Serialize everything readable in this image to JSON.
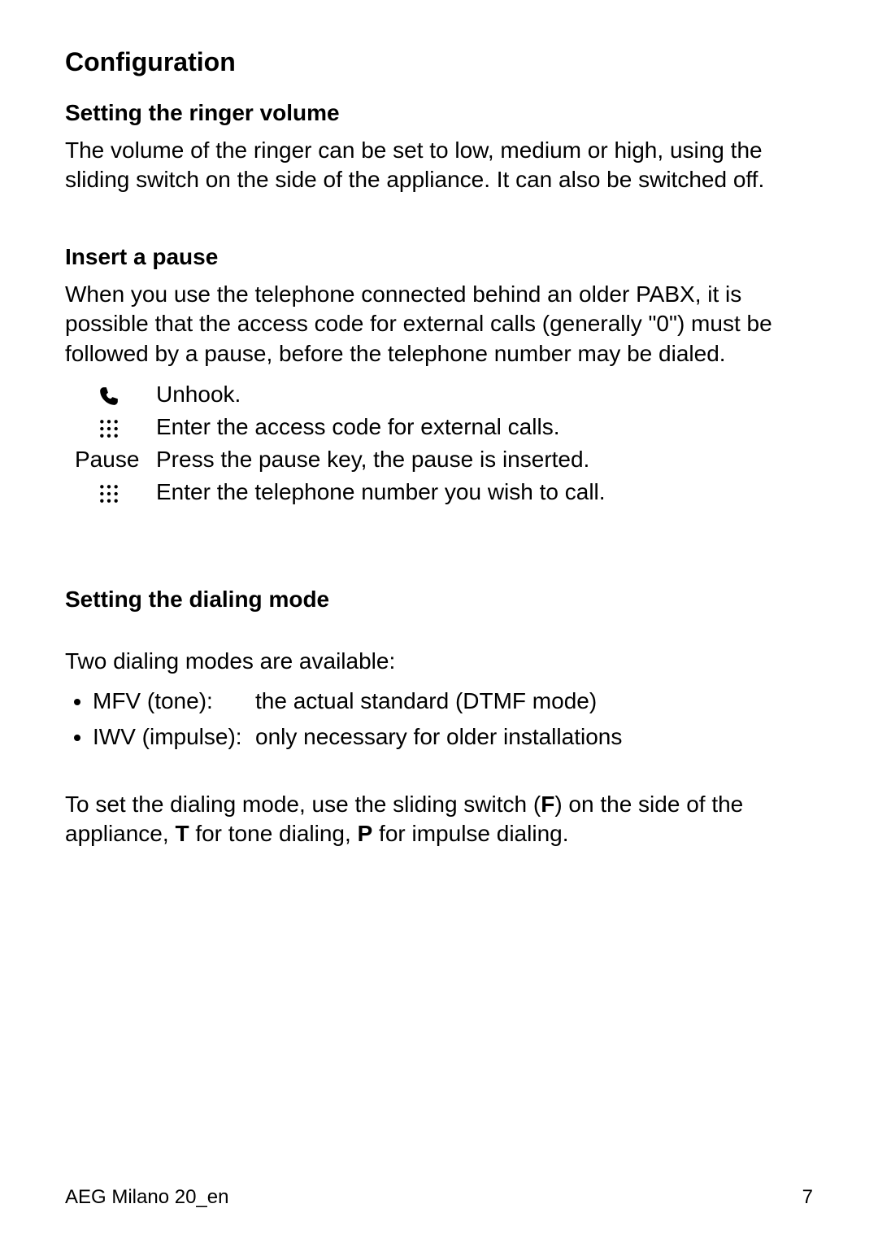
{
  "title": "Configuration",
  "s1": {
    "heading": "Setting the ringer volume",
    "body": "The volume of the ringer can be set to low, medium or high, using the sliding switch on the side of the appliance. It can also be switched off."
  },
  "s2": {
    "heading": "Insert a pause",
    "body": "When you use the telephone connected behind an older PABX, it is possible that the access code for external calls (generally \"0\") must be followed by a pause, before the telephone number may be dialed.",
    "step1": "Unhook.",
    "step2": "Enter the access code for external calls.",
    "step3_label": "Pause",
    "step3": "Press the pause key, the pause is inserted.",
    "step4": "Enter the telephone number you wish to call."
  },
  "s3": {
    "heading": "Setting the dialing mode",
    "intro": "Two dialing modes are available:",
    "b1_key": "MFV (tone):",
    "b1_val": "the actual standard (DTMF mode)",
    "b2_key": "IWV (impulse):",
    "b2_val": "only necessary for older installations",
    "outro_pre": "To set the dialing mode, use the sliding switch (",
    "outro_F": "F",
    "outro_mid1": ") on the side of the appliance, ",
    "outro_T": "T",
    "outro_mid2": " for tone dialing, ",
    "outro_P": "P",
    "outro_end": " for impulse dialing."
  },
  "footer": {
    "left": "AEG Milano 20_en",
    "right": "7"
  }
}
